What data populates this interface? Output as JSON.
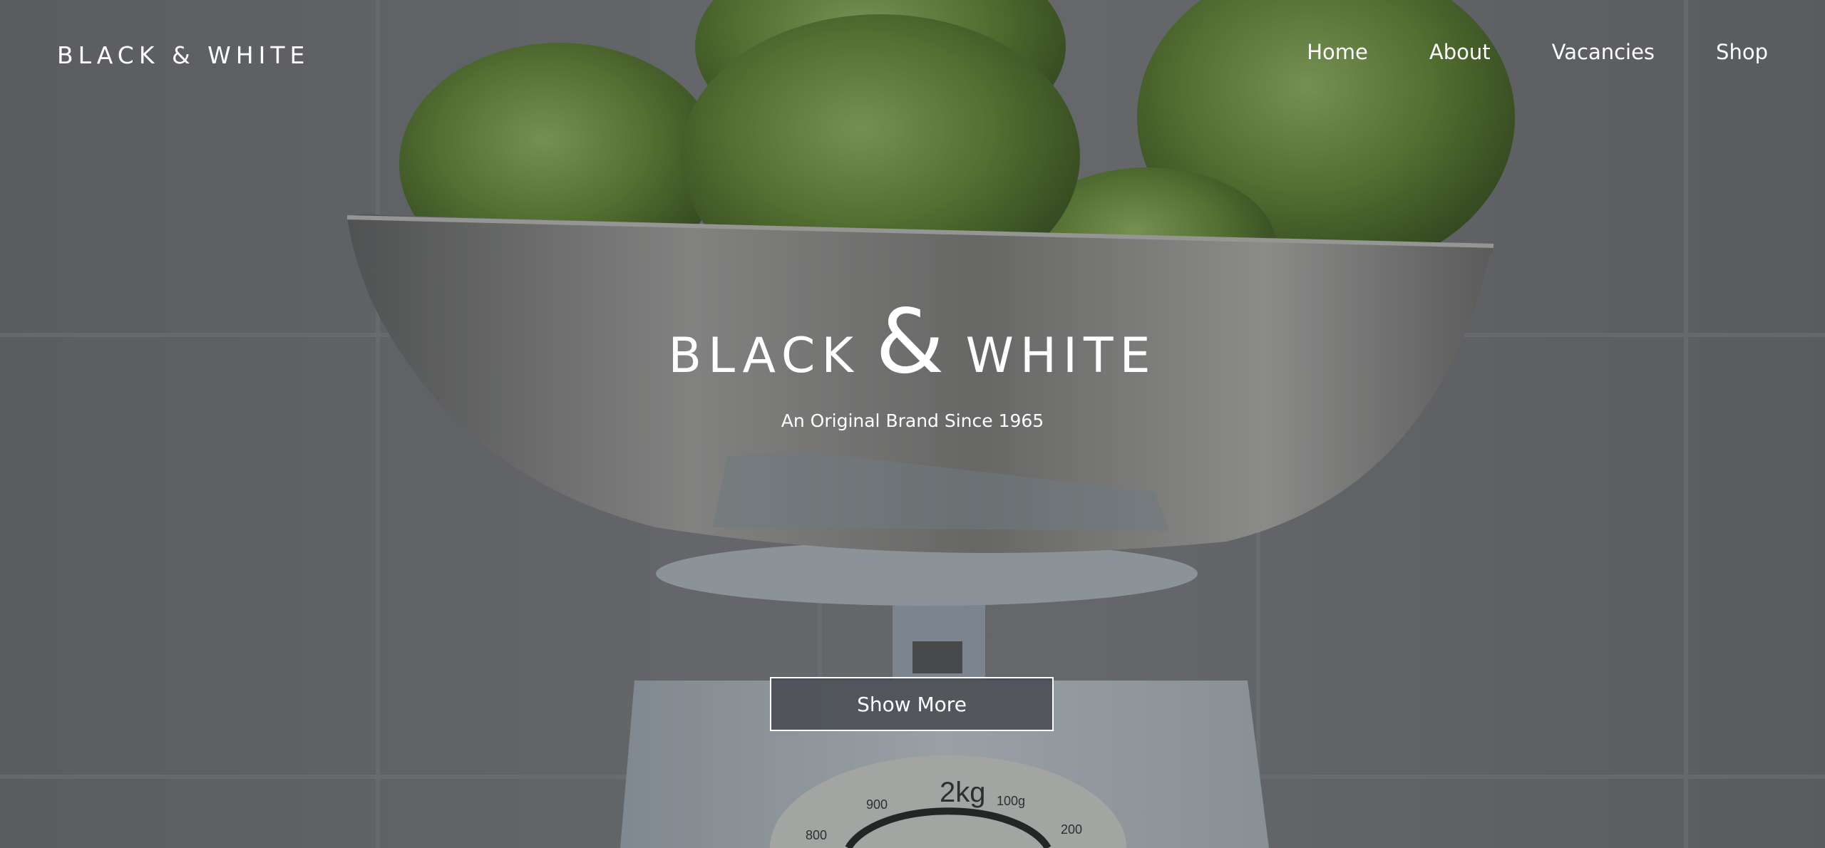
{
  "header": {
    "brand": "BLACK & WHITE",
    "nav": [
      {
        "label": "Home"
      },
      {
        "label": "About"
      },
      {
        "label": "Vacancies"
      },
      {
        "label": "Shop"
      }
    ]
  },
  "hero": {
    "title_left": "BLACK",
    "title_amp": "&",
    "title_right": "WHITE",
    "tagline": "An Original Brand Since 1965",
    "button_label": "Show More",
    "scale_labels": [
      "2kg",
      "900",
      "100g",
      "800",
      "200"
    ]
  },
  "colors": {
    "apple_green": "#6f9a35",
    "overlay": "#2a2c2f",
    "text": "#ffffff"
  }
}
